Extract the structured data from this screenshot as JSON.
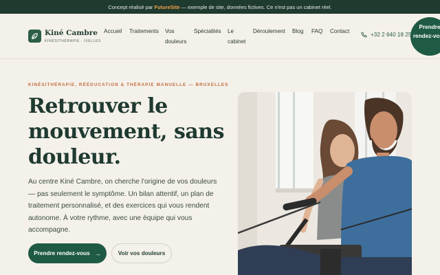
{
  "topbar": {
    "prefix": "Concept réalisé par",
    "brand": "FutureSite",
    "suffix": "— exemple de site, données fictives. Ce n'est pas un cabinet réel."
  },
  "logo": {
    "name": "Kiné Cambre",
    "tagline": "KINÉSITHÉRAPIE · IXELLES"
  },
  "nav": {
    "items": [
      "Accueil",
      "Traitements",
      "Vos douleurs",
      "Spécialités",
      "Le cabinet",
      "Déroulement",
      "Blog",
      "FAQ",
      "Contact"
    ]
  },
  "phone": "+32 2 640 18 25",
  "header_cta": "Prendre rendez-vous",
  "hero": {
    "eyebrow": "KINÉSITHÉRAPIE, RÉÉDUCATION & THÉRAPIE MANUELLE — BRUXELLES",
    "headline": "Retrouver le mouvement, sans douleur.",
    "lead": "Au centre Kiné Cambre, on cherche l'origine de vos douleurs — pas seulement le symptôme. Un bilan attentif, un plan de traitement personnalisé, et des exercices qui vous rendent autonome. À votre rythme, avec une équipe qui vous accompagne.",
    "primary_button": "Prendre rendez-vous",
    "secondary_button": "Voir vos douleurs"
  },
  "colors": {
    "dark_green": "#1f3a2e",
    "brand_green": "#1f5a44",
    "accent_orange": "#f0a04b",
    "eyebrow_terracotta": "#c06a3a",
    "background": "#f4f1ea"
  },
  "icons": [
    "leaf-logo-icon",
    "phone-icon",
    "arrow-right-icon"
  ]
}
